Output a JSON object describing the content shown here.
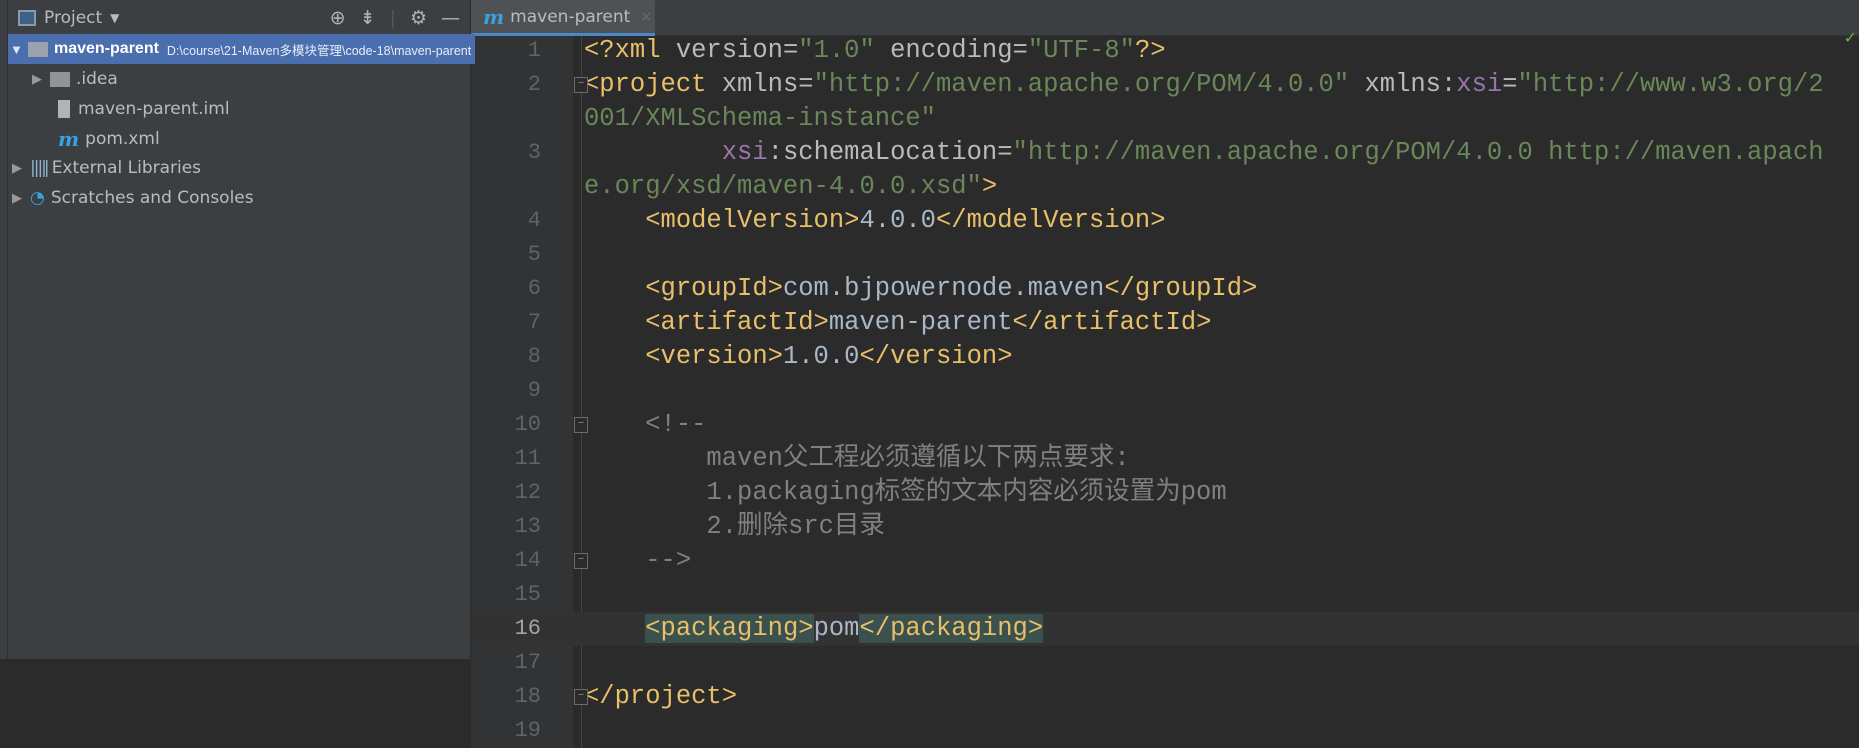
{
  "sidebar": {
    "title": "Project",
    "items": [
      {
        "name": "maven-parent",
        "path": "D:\\course\\21-Maven多模块管理\\code-18\\maven-parent"
      },
      {
        "name": ".idea"
      },
      {
        "name": "maven-parent.iml"
      },
      {
        "name": "pom.xml"
      },
      {
        "name": "External Libraries"
      },
      {
        "name": "Scratches and Consoles"
      }
    ]
  },
  "tab": {
    "label": "maven-parent"
  },
  "editor": {
    "current_line": 16,
    "lines": [
      {
        "n": "1",
        "code": "<?xml version=\"1.0\" encoding=\"UTF-8\"?>"
      },
      {
        "n": "2",
        "code": "<project xmlns=\"http://maven.apache.org/POM/4.0.0\" xmlns:xsi=\"http://www.w3.org/2001/XMLSchema-instance\""
      },
      {
        "n": "3",
        "code": "         xsi:schemaLocation=\"http://maven.apache.org/POM/4.0.0 http://maven.apache.org/xsd/maven-4.0.0.xsd\">"
      },
      {
        "n": "4",
        "code": "    <modelVersion>4.0.0</modelVersion>"
      },
      {
        "n": "5",
        "code": ""
      },
      {
        "n": "6",
        "code": "    <groupId>com.bjpowernode.maven</groupId>"
      },
      {
        "n": "7",
        "code": "    <artifactId>maven-parent</artifactId>"
      },
      {
        "n": "8",
        "code": "    <version>1.0.0</version>"
      },
      {
        "n": "9",
        "code": ""
      },
      {
        "n": "10",
        "code": "    <!--"
      },
      {
        "n": "11",
        "code": "        maven父工程必须遵循以下两点要求:"
      },
      {
        "n": "12",
        "code": "        1.packaging标签的文本内容必须设置为pom"
      },
      {
        "n": "13",
        "code": "        2.删除src目录"
      },
      {
        "n": "14",
        "code": "    -->"
      },
      {
        "n": "15",
        "code": ""
      },
      {
        "n": "16",
        "code": "    <packaging>pom</packaging>"
      },
      {
        "n": "17",
        "code": ""
      },
      {
        "n": "18",
        "code": "</project>"
      },
      {
        "n": "19",
        "code": ""
      }
    ]
  },
  "colors": {
    "tag": "#e8bf6a",
    "attr": "#bababa",
    "value": "#6a8759",
    "comment": "#808080",
    "selection": "#4b6eaf"
  }
}
